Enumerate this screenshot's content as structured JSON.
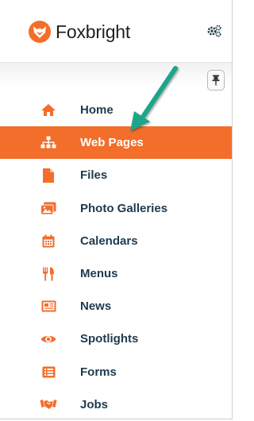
{
  "brand": {
    "name": "Foxbright"
  },
  "colors": {
    "accent": "#f36e2a",
    "text": "#1f3a4d",
    "annotation_arrow": "#1aa58a"
  },
  "nav": {
    "items": [
      {
        "label": "Home",
        "icon": "home-icon"
      },
      {
        "label": "Web Pages",
        "icon": "sitemap-icon",
        "active": true
      },
      {
        "label": "Files",
        "icon": "file-icon"
      },
      {
        "label": "Photo Galleries",
        "icon": "images-icon"
      },
      {
        "label": "Calendars",
        "icon": "calendar-icon"
      },
      {
        "label": "Menus",
        "icon": "utensils-icon"
      },
      {
        "label": "News",
        "icon": "newspaper-icon"
      },
      {
        "label": "Spotlights",
        "icon": "eye-icon"
      },
      {
        "label": "Forms",
        "icon": "form-list-icon"
      },
      {
        "label": "Jobs",
        "icon": "handshake-icon"
      }
    ]
  }
}
